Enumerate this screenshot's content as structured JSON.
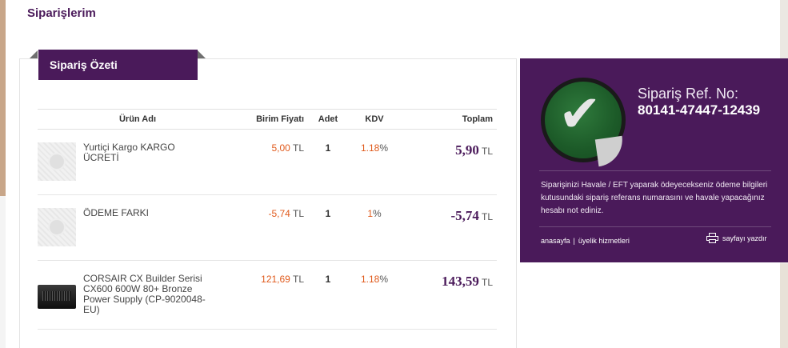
{
  "page": {
    "title": "Siparişlerim"
  },
  "summary": {
    "ribbon_label": "Sipariş Özeti"
  },
  "table": {
    "headers": {
      "name": "Ürün Adı",
      "unit_price": "Birim Fiyatı",
      "qty": "Adet",
      "kdv": "KDV",
      "total": "Toplam"
    },
    "rows": [
      {
        "name": "Yurtiçi Kargo KARGO ÜCRETİ",
        "unit_price": "5,00",
        "unit_currency": "TL",
        "qty": "1",
        "kdv": "1.18",
        "kdv_suffix": "%",
        "total": "5,90",
        "total_currency": "TL"
      },
      {
        "name": "ÖDEME FARKI",
        "unit_price": "-5,74",
        "unit_currency": "TL",
        "qty": "1",
        "kdv": "1",
        "kdv_suffix": "%",
        "total": "-5,74",
        "total_currency": "TL"
      },
      {
        "name": "CORSAIR CX Builder Serisi CX600 600W 80+ Bronze Power Supply (CP-9020048-EU)",
        "unit_price": "121,69",
        "unit_currency": "TL",
        "qty": "1",
        "kdv": "1.18",
        "kdv_suffix": "%",
        "total": "143,59",
        "total_currency": "TL"
      }
    ]
  },
  "side": {
    "ref_label": "Sipariş Ref. No:",
    "ref_number": "80141-47447-12439",
    "note": "Siparişinizi Havale / EFT yaparak ödeyecekseniz ödeme bilgileri kutusundaki sipariş referans numarasını ve havale yapacağınız hesabı not ediniz.",
    "links": {
      "home": "anasayfa",
      "separator": "|",
      "membership": "üyelik hizmetleri"
    },
    "print_label": "sayfayı yazdır"
  },
  "colors": {
    "brand_purple": "#4a1a5a",
    "price_orange": "#e05a1c",
    "badge_green": "#2f7a3c"
  }
}
